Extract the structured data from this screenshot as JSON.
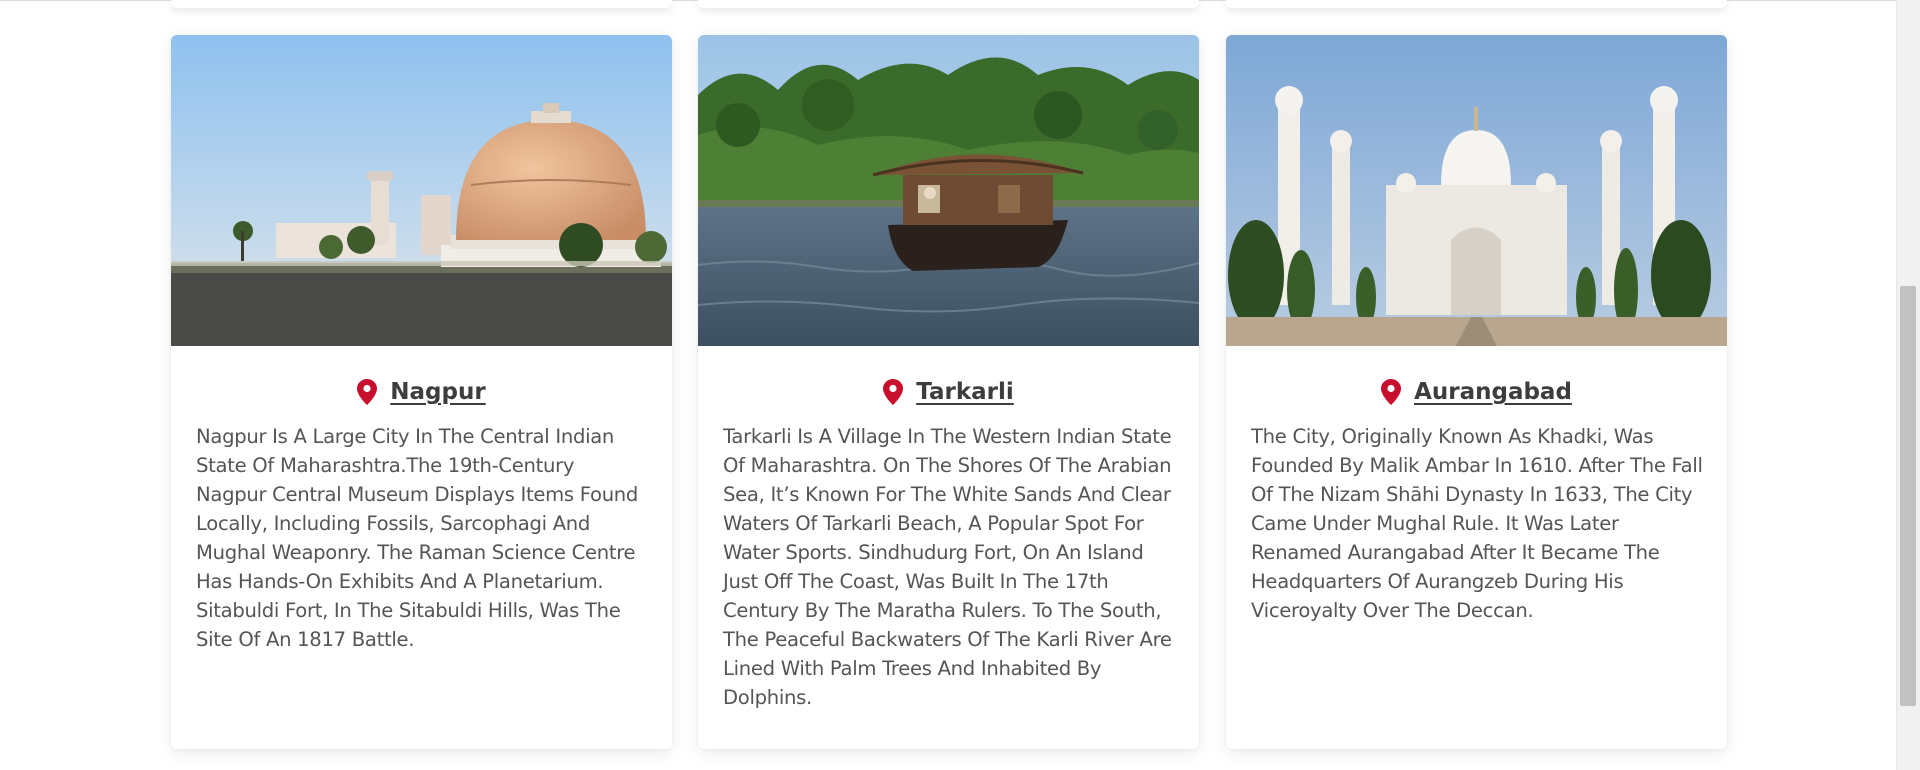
{
  "cards": [
    {
      "title": "Nagpur",
      "description": "Nagpur Is A Large City In The Central Indian State Of Maharashtra.The 19th-Century Nagpur Central Museum Displays Items Found Locally, Including Fossils, Sarcophagi And Mughal Weaponry. The Raman Science Centre Has Hands-On Exhibits And A Planetarium. Sitabuldi Fort, In The Sitabuldi Hills, Was The Site Of An 1817 Battle.",
      "icon": "map-pin-icon"
    },
    {
      "title": "Tarkarli",
      "description": "Tarkarli Is A Village In The Western Indian State Of Maharashtra. On The Shores Of The Arabian Sea, It’s Known For The White Sands And Clear Waters Of Tarkarli Beach, A Popular Spot For Water Sports. Sindhudurg Fort, On An Island Just Off The Coast, Was Built In The 17th Century By The Maratha Rulers. To The South, The Peaceful Backwaters Of The Karli River Are Lined With Palm Trees And Inhabited By Dolphins.",
      "icon": "map-pin-icon"
    },
    {
      "title": "Aurangabad",
      "description": "The City, Originally Known As Khadki, Was Founded By Malik Ambar In 1610. After The Fall Of The Nizam Shāhi Dynasty In 1633, The City Came Under Mughal Rule. It Was Later Renamed Aurangabad After It Became The Headquarters Of Aurangzeb During His Viceroyalty Over The Deccan.",
      "icon": "map-pin-icon"
    }
  ],
  "colors": {
    "pin": "#c8102e",
    "title": "#3d3d3d",
    "text": "#555555"
  }
}
